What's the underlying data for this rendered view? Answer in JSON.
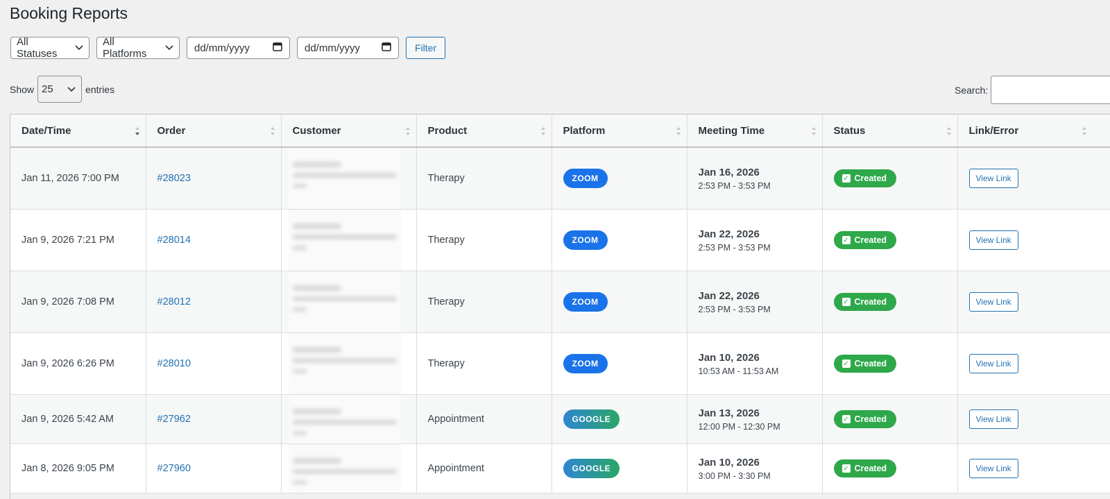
{
  "page": {
    "title": "Booking Reports"
  },
  "filters": {
    "status": "All Statuses",
    "platform": "All Platforms",
    "date_from_placeholder": "dd/mm/yyyy",
    "date_to_placeholder": "dd/mm/yyyy",
    "filter_label": "Filter"
  },
  "table_controls": {
    "show_label": "Show",
    "page_length": "25",
    "entries_label": "entries",
    "search_label": "Search:",
    "search_value": ""
  },
  "table": {
    "columns": [
      "Date/Time",
      "Order",
      "Customer",
      "Product",
      "Platform",
      "Meeting Time",
      "Status",
      "Link/Error"
    ],
    "rows": [
      {
        "datetime": "Jan 11, 2026 7:00 PM",
        "order": "#28023",
        "product": "Therapy",
        "platform": "ZOOM",
        "platform_type": "zoom",
        "meeting_date": "Jan 16, 2026",
        "meeting_range": "2:53 PM - 3:53 PM",
        "status": "Created",
        "link": "View Link"
      },
      {
        "datetime": "Jan 9, 2026 7:21 PM",
        "order": "#28014",
        "product": "Therapy",
        "platform": "ZOOM",
        "platform_type": "zoom",
        "meeting_date": "Jan 22, 2026",
        "meeting_range": "2:53 PM - 3:53 PM",
        "status": "Created",
        "link": "View Link"
      },
      {
        "datetime": "Jan 9, 2026 7:08 PM",
        "order": "#28012",
        "product": "Therapy",
        "platform": "ZOOM",
        "platform_type": "zoom",
        "meeting_date": "Jan 22, 2026",
        "meeting_range": "2:53 PM - 3:53 PM",
        "status": "Created",
        "link": "View Link"
      },
      {
        "datetime": "Jan 9, 2026 6:26 PM",
        "order": "#28010",
        "product": "Therapy",
        "platform": "ZOOM",
        "platform_type": "zoom",
        "meeting_date": "Jan 10, 2026",
        "meeting_range": "10:53 AM - 11:53 AM",
        "status": "Created",
        "link": "View Link"
      },
      {
        "datetime": "Jan 9, 2026 5:42 AM",
        "order": "#27962",
        "product": "Appointment",
        "platform": "GOOGLE",
        "platform_type": "google",
        "meeting_date": "Jan 13, 2026",
        "meeting_range": "12:00 PM - 12:30 PM",
        "status": "Created",
        "link": "View Link"
      },
      {
        "datetime": "Jan 8, 2026 9:05 PM",
        "order": "#27960",
        "product": "Appointment",
        "platform": "GOOGLE",
        "platform_type": "google",
        "meeting_date": "Jan 10, 2026",
        "meeting_range": "3:00 PM - 3:30 PM",
        "status": "Created",
        "link": "View Link"
      }
    ]
  },
  "colors": {
    "link_blue": "#2271b1",
    "zoom_blue": "#1a73e8",
    "status_green": "#2ea84a"
  }
}
